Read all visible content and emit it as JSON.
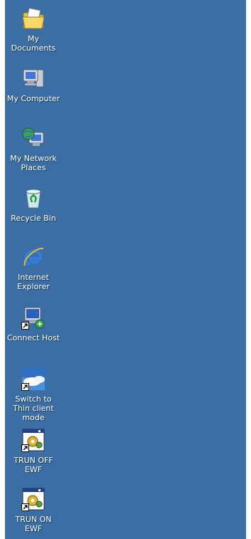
{
  "desktop": {
    "background_color": "#3A6EA5",
    "icons": [
      {
        "label": "My Documents",
        "icon": "my-documents-icon",
        "shortcut": false
      },
      {
        "label": "My Computer",
        "icon": "my-computer-icon",
        "shortcut": false
      },
      {
        "label": "My Network Places",
        "icon": "my-network-places-icon",
        "shortcut": false
      },
      {
        "label": "Recycle Bin",
        "icon": "recycle-bin-icon",
        "shortcut": false
      },
      {
        "label": "Internet Explorer",
        "icon": "internet-explorer-icon",
        "shortcut": false
      },
      {
        "label": "Connect Host",
        "icon": "connect-host-icon",
        "shortcut": true
      },
      {
        "label": "Switch to Thin client mode",
        "icon": "switch-thin-client-icon",
        "shortcut": true
      },
      {
        "label": "TRUN OFF EWF",
        "icon": "ewf-gear-icon",
        "shortcut": true
      },
      {
        "label": "TRUN ON EWF",
        "icon": "ewf-gear-icon",
        "shortcut": true
      }
    ]
  }
}
